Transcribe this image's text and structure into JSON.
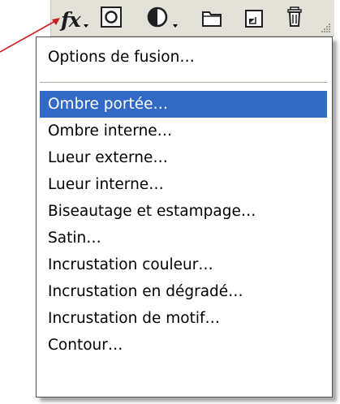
{
  "toolbar": {
    "fx_label": "fx",
    "icons": [
      "fx-icon",
      "layer-mask-icon",
      "adjustment-layer-icon",
      "folder-icon",
      "new-layer-icon",
      "trash-icon"
    ]
  },
  "menu": {
    "header_item": "Options de fusion…",
    "items": [
      "Ombre portée…",
      "Ombre interne…",
      "Lueur externe…",
      "Lueur interne…",
      "Biseautage et estampage…",
      "Satin…",
      "Incrustation couleur…",
      "Incrustation en dégradé…",
      "Incrustation de motif…",
      "Contour…"
    ],
    "selected_item": "Ombre portée…"
  },
  "colors": {
    "selection": "#316ac5",
    "toolbar_bg": "#e4e2d8",
    "arrow": "#cc1f1f"
  }
}
